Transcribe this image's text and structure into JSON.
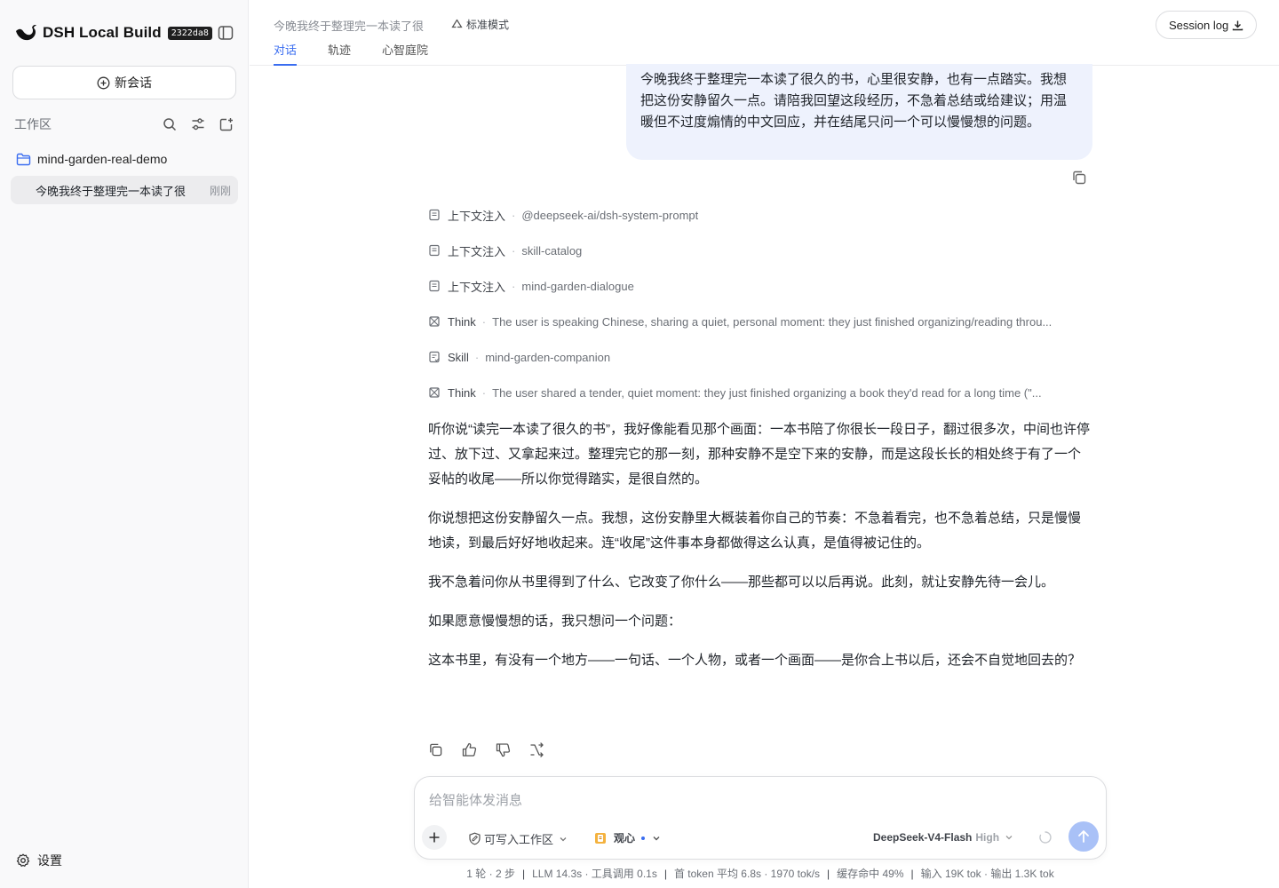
{
  "app": {
    "name": "DSH Local Build",
    "build": "2322da8"
  },
  "sidebar": {
    "new_chat_label": "新会话",
    "workspace_label": "工作区",
    "folder_name": "mind-garden-real-demo",
    "sessions": [
      {
        "title": "今晚我终于整理完一本读了很",
        "time": "刚刚"
      }
    ],
    "settings_label": "设置"
  },
  "header": {
    "conversation_title": "今晚我终于整理完一本读了很",
    "mode_label": "标准模式",
    "tabs": [
      {
        "label": "对话",
        "active": true
      },
      {
        "label": "轨迹",
        "active": false
      },
      {
        "label": "心智庭院",
        "active": false
      }
    ],
    "session_log_label": "Session log"
  },
  "conversation": {
    "user_message": "今晚我终于整理完一本读了很久的书，心里很安静，也有一点踏实。我想把这份安静留久一点。请陪我回望这段经历，不急着总结或给建议；用温暖但不过度煽情的中文回应，并在结尾只问一个可以慢慢想的问题。",
    "trace": [
      {
        "kind": "上下文注入",
        "detail": "@deepseek-ai/dsh-system-prompt",
        "icon": "document-icon"
      },
      {
        "kind": "上下文注入",
        "detail": "skill-catalog",
        "icon": "document-icon"
      },
      {
        "kind": "上下文注入",
        "detail": "mind-garden-dialogue",
        "icon": "document-icon"
      },
      {
        "kind": "Think",
        "detail": "The user is speaking Chinese, sharing a quiet, personal moment: they just finished organizing/reading throu...",
        "icon": "think-icon"
      },
      {
        "kind": "Skill",
        "detail": "mind-garden-companion",
        "icon": "skill-icon"
      },
      {
        "kind": "Think",
        "detail": "The user shared a tender, quiet moment: they just finished organizing a book they'd read for a long time (\"...",
        "icon": "think-icon"
      }
    ],
    "reply_paragraphs": [
      "听你说“读完一本读了很久的书”，我好像能看见那个画面：一本书陪了你很长一段日子，翻过很多次，中间也许停过、放下过、又拿起来过。整理完它的那一刻，那种安静不是空下来的安静，而是这段长长的相处终于有了一个妥帖的收尾——所以你觉得踏实，是很自然的。",
      "你说想把这份安静留久一点。我想，这份安静里大概装着你自己的节奏：不急着看完，也不急着总结，只是慢慢地读，到最后好好地收起来。连“收尾”这件事本身都做得这么认真，是值得被记住的。",
      "我不急着问你从书里得到了什么、它改变了你什么——那些都可以以后再说。此刻，就让安静先待一会儿。",
      "如果愿意慢慢想的话，我只想问一个问题：",
      "这本书里，有没有一个地方——一句话、一个人物，或者一个画面——是你合上书以后，还会不自觉地回去的？"
    ]
  },
  "composer": {
    "placeholder": "给智能体发消息",
    "permission_label": "可写入工作区",
    "persona_label": "观心",
    "model_name": "DeepSeek-V4-Flash",
    "model_effort": "High"
  },
  "stats": {
    "rounds": "1 轮 · 2 步",
    "llm": "LLM 14.3s · 工具调用 0.1s",
    "token_rate": "首 token 平均 6.8s · 1970 tok/s",
    "cache": "缓存命中 49%",
    "io": "输入 19K tok · 输出 1.3K tok"
  },
  "colors": {
    "accent": "#3a6df0",
    "user_bubble": "#eef2fd",
    "send_button": "#a9c1f7",
    "sidebar_bg": "#f9f9fa"
  }
}
